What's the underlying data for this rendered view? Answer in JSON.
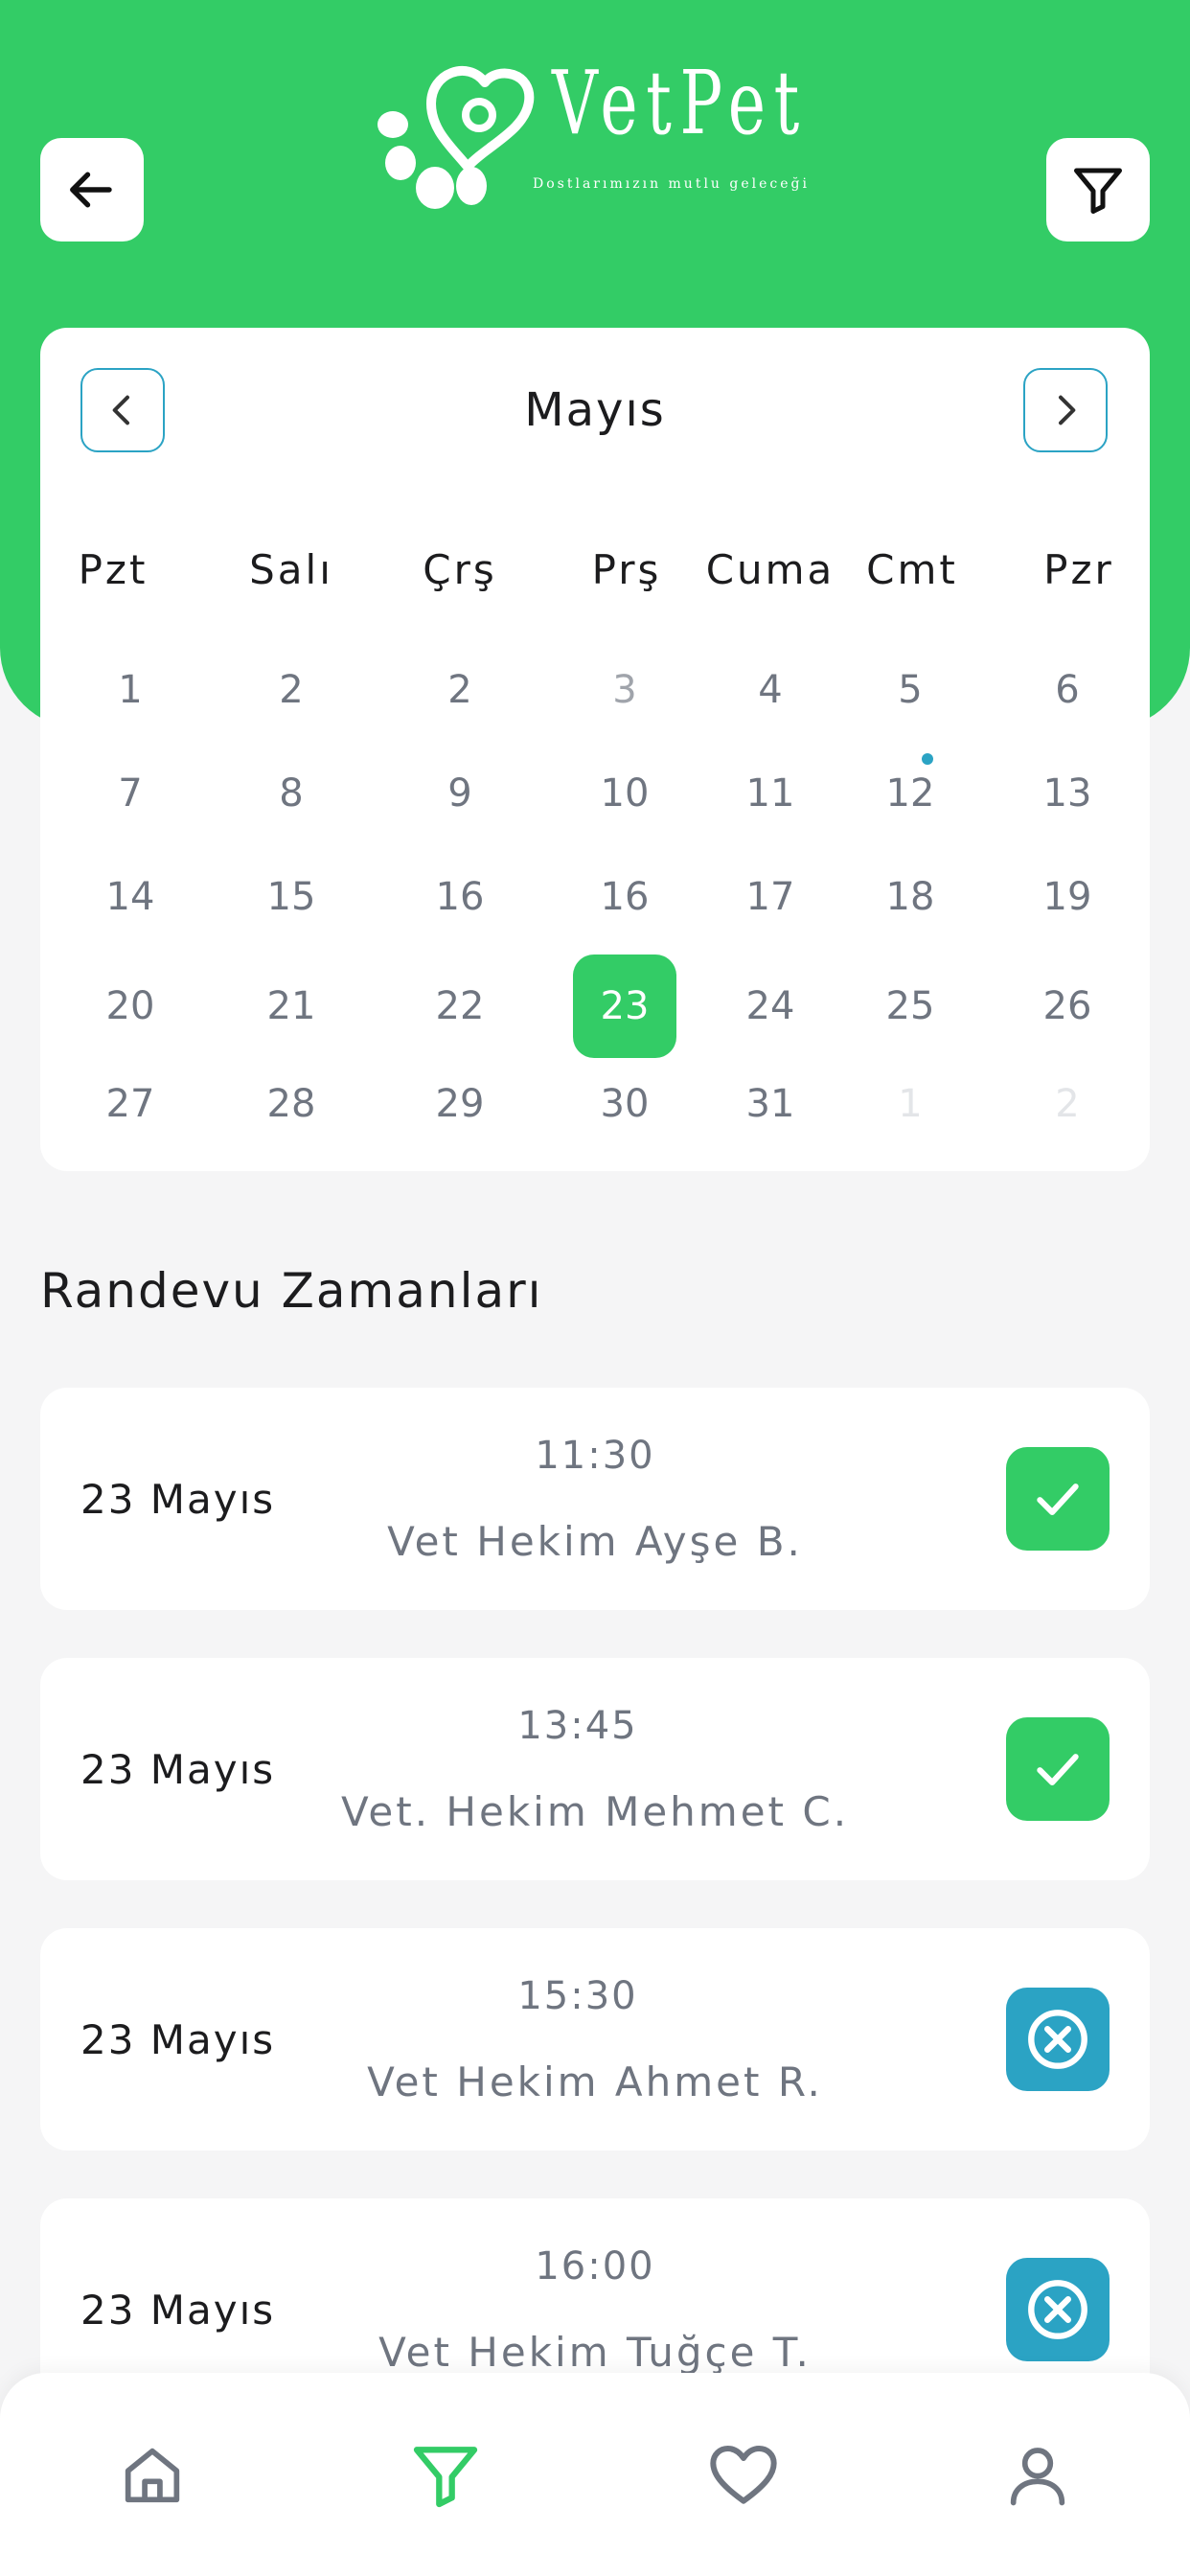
{
  "app": {
    "brand_name": "VetPet",
    "brand_tagline": "Dostlarımızın mutlu geleceği",
    "accent_color": "#33cc66",
    "secondary_color": "#2ba3c4"
  },
  "header": {
    "back_icon": "arrow-left-icon",
    "filter_icon": "filter-icon"
  },
  "calendar": {
    "month": "Mayıs",
    "prev_icon": "chevron-left-icon",
    "next_icon": "chevron-right-icon",
    "weekdays": [
      "Pzt",
      "Salı",
      "Çrş",
      "Prş",
      "Cuma",
      "Cmt",
      "Pzr"
    ],
    "weeks": [
      [
        "1",
        "2",
        "2",
        "3",
        "4",
        "5",
        "6"
      ],
      [
        "7",
        "8",
        "9",
        "10",
        "11",
        "12",
        "13"
      ],
      [
        "14",
        "15",
        "16",
        "16",
        "17",
        "18",
        "19"
      ],
      [
        "20",
        "21",
        "22",
        "23",
        "24",
        "25",
        "26"
      ],
      [
        "27",
        "28",
        "29",
        "30",
        "31",
        "1",
        "2"
      ]
    ],
    "selected_day": "23",
    "event_day": "12"
  },
  "appointments": {
    "title": "Randevu Zamanları",
    "items": [
      {
        "date": "23 Mayıs",
        "time": "11:30",
        "vet": "Vet Hekim Ayşe B.",
        "status": "confirmed"
      },
      {
        "date": "23 Mayıs",
        "time": "13:45",
        "vet": "Vet. Hekim Mehmet C.",
        "status": "confirmed"
      },
      {
        "date": "23 Mayıs",
        "time": "15:30",
        "vet": "Vet Hekim Ahmet R.",
        "status": "cancelled"
      },
      {
        "date": "23 Mayıs",
        "time": "16:00",
        "vet": "Vet Hekim Tuğçe T.",
        "status": "cancelled"
      }
    ]
  },
  "bottom_nav": {
    "tabs": [
      "home-icon",
      "filter-icon",
      "heart-icon",
      "user-icon"
    ],
    "active": "filter-icon"
  }
}
